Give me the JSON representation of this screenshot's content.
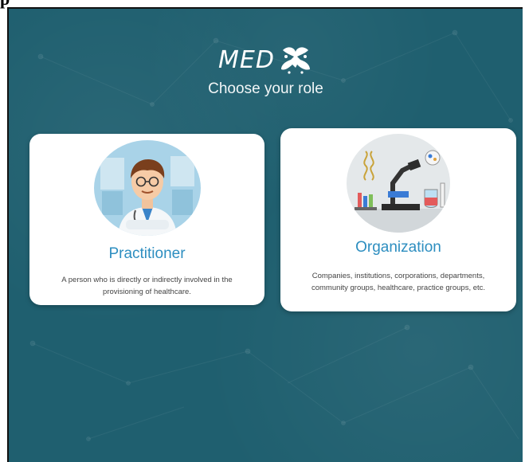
{
  "heading_fragment": "p",
  "app": {
    "logo_text": "MED",
    "subtitle": "Choose your role"
  },
  "roles": [
    {
      "title": "Practitioner",
      "description": "A person who is directly or indirectly involved in the provisioning of healthcare.",
      "image_icon": "doctor-avatar-icon"
    },
    {
      "title": "Organization",
      "description": "Companies, institutions, corporations, departments, community groups, healthcare, practice groups, etc.",
      "image_icon": "lab-equipment-icon"
    }
  ],
  "colors": {
    "background": "#1f5f6f",
    "card": "#ffffff",
    "accent": "#2d8ec0"
  }
}
